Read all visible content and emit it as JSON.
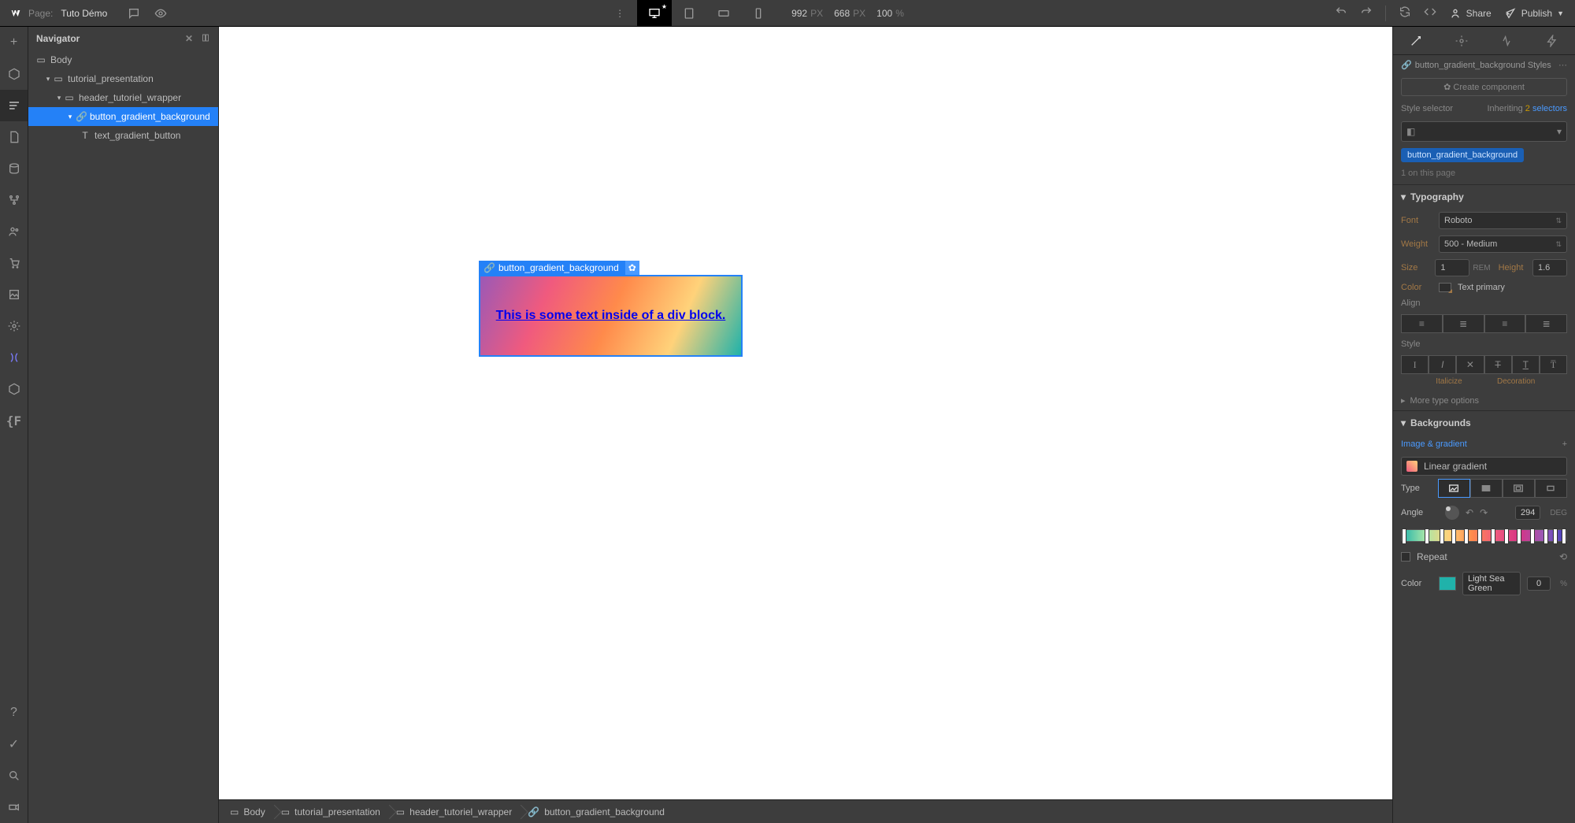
{
  "topbar": {
    "page_label": "Page:",
    "page_name": "Tuto Démo",
    "width": "992",
    "width_unit": "PX",
    "height": "668",
    "height_unit": "PX",
    "zoom": "100",
    "zoom_unit": "%",
    "share": "Share",
    "publish": "Publish"
  },
  "navigator": {
    "title": "Navigator",
    "tree": {
      "body": "Body",
      "tutorial": "tutorial_presentation",
      "header": "header_tutoriel_wrapper",
      "button": "button_gradient_background",
      "text": "text_gradient_button"
    }
  },
  "canvas": {
    "label": "button_gradient_background",
    "text": "This is some text inside of a div block."
  },
  "breadcrumbs": [
    "Body",
    "tutorial_presentation",
    "header_tutoriel_wrapper",
    "button_gradient_background"
  ],
  "styles": {
    "header": "button_gradient_background Styles",
    "create_component": "Create component",
    "selector_label": "Style selector",
    "inheriting": "Inheriting",
    "inheriting_count": "2",
    "inheriting_suffix": "selectors",
    "class_name": "button_gradient_background",
    "on_page": "1 on this page",
    "typography": {
      "title": "Typography",
      "font_label": "Font",
      "font_value": "Roboto",
      "weight_label": "Weight",
      "weight_value": "500 - Medium",
      "size_label": "Size",
      "size_value": "1",
      "size_unit": "REM",
      "height_label": "Height",
      "height_value": "1.6",
      "color_label": "Color",
      "color_value": "Text primary",
      "align_label": "Align",
      "style_label": "Style",
      "italicize": "Italicize",
      "decoration": "Decoration",
      "more": "More type options"
    },
    "backgrounds": {
      "title": "Backgrounds",
      "img_grad": "Image & gradient",
      "linear": "Linear gradient",
      "type_label": "Type",
      "angle_label": "Angle",
      "angle_value": "294",
      "angle_unit": "DEG",
      "repeat_label": "Repeat",
      "color_label": "Color",
      "color_name": "Light Sea Green",
      "color_pct": "0",
      "color_pct_unit": "%"
    }
  }
}
